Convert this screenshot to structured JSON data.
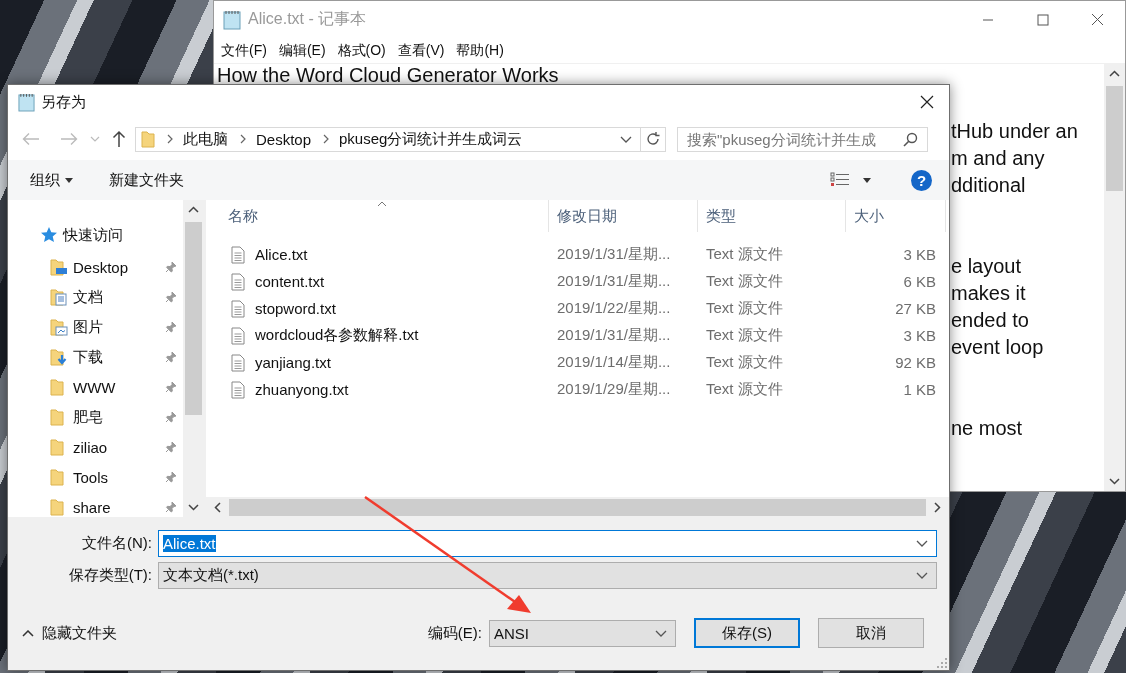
{
  "notepad": {
    "title": "Alice.txt - 记事本",
    "menu": [
      "文件(F)",
      "编辑(E)",
      "格式(O)",
      "查看(V)",
      "帮助(H)"
    ],
    "heading": "How the Word Cloud Generator Works",
    "paragraphs": [
      [
        "tHub under an",
        "m and any",
        "dditional"
      ],
      [
        "e layout",
        "makes it",
        "ended to",
        "event loop"
      ],
      [
        "ne most"
      ]
    ]
  },
  "dialog": {
    "title": "另存为",
    "breadcrumb": [
      "此电脑",
      "Desktop",
      "pkuseg分词统计并生成词云"
    ],
    "search": {
      "placeholder": "搜索\"pkuseg分词统计并生成"
    },
    "toolbar": {
      "organize": "组织",
      "new_folder": "新建文件夹",
      "help": "?"
    },
    "nav": {
      "quick_access": "快速访问",
      "items": [
        {
          "label": "Desktop",
          "kind": "desktop",
          "pinned": true
        },
        {
          "label": "文档",
          "kind": "documents",
          "pinned": true
        },
        {
          "label": "图片",
          "kind": "pictures",
          "pinned": true
        },
        {
          "label": "下载",
          "kind": "downloads",
          "pinned": true
        },
        {
          "label": "WWW",
          "kind": "folder",
          "pinned": true
        },
        {
          "label": "肥皂",
          "kind": "folder",
          "pinned": true
        },
        {
          "label": "ziliao",
          "kind": "folder",
          "pinned": true
        },
        {
          "label": "Tools",
          "kind": "folder",
          "pinned": true
        },
        {
          "label": "share",
          "kind": "folder",
          "pinned": true
        }
      ]
    },
    "columns": [
      {
        "label": "名称",
        "sorted": true
      },
      {
        "label": "修改日期",
        "sorted": false
      },
      {
        "label": "类型",
        "sorted": false
      },
      {
        "label": "大小",
        "sorted": false
      }
    ],
    "files": [
      {
        "name": "Alice.txt",
        "modified": "2019/1/31/星期...",
        "type": "Text 源文件",
        "size": "3 KB"
      },
      {
        "name": "content.txt",
        "modified": "2019/1/31/星期...",
        "type": "Text 源文件",
        "size": "6 KB"
      },
      {
        "name": "stopword.txt",
        "modified": "2019/1/22/星期...",
        "type": "Text 源文件",
        "size": "27 KB"
      },
      {
        "name": "wordcloud各参数解释.txt",
        "modified": "2019/1/31/星期...",
        "type": "Text 源文件",
        "size": "3 KB"
      },
      {
        "name": "yanjiang.txt",
        "modified": "2019/1/14/星期...",
        "type": "Text 源文件",
        "size": "92 KB"
      },
      {
        "name": "zhuanyong.txt",
        "modified": "2019/1/29/星期...",
        "type": "Text 源文件",
        "size": "1 KB"
      }
    ],
    "filename": {
      "label": "文件名(N):",
      "value": "Alice.txt",
      "text_selected": true
    },
    "save_type": {
      "label": "保存类型(T):",
      "value": "文本文档(*.txt)"
    },
    "hide_folders": "隐藏文件夹",
    "encoding": {
      "label": "编码(E):",
      "value": "ANSI"
    },
    "buttons": [
      {
        "label": "保存(S)",
        "default": true
      },
      {
        "label": "取消",
        "default": false
      }
    ]
  }
}
